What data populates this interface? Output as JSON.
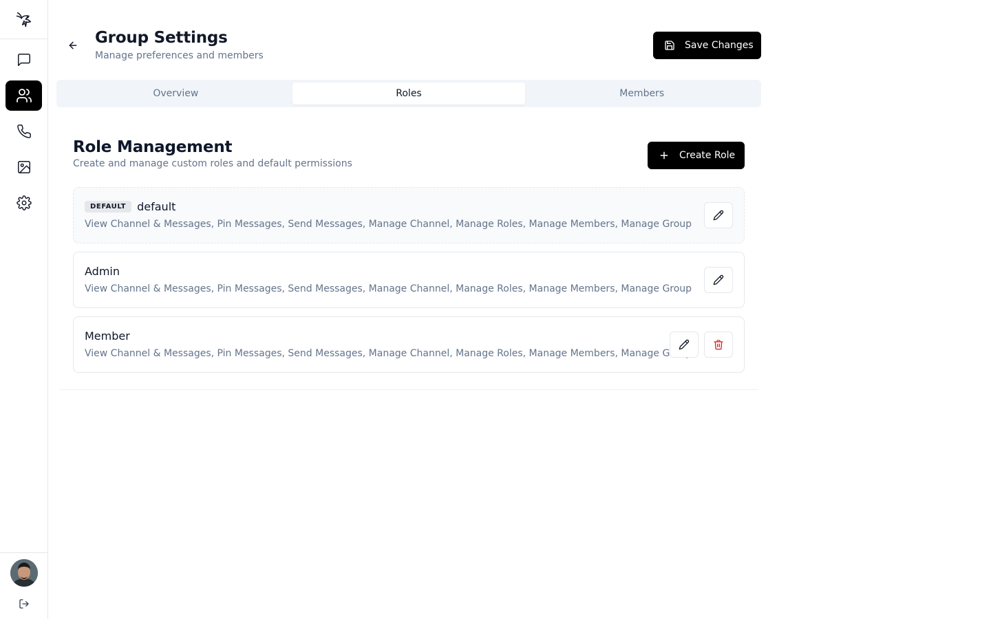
{
  "sidebar": {
    "logo_icon": "hummingbird-logo",
    "items": [
      {
        "icon": "message-square-icon",
        "label": "Chats"
      },
      {
        "icon": "users-icon",
        "label": "Groups",
        "active": true
      },
      {
        "icon": "phone-icon",
        "label": "Calls"
      },
      {
        "icon": "image-icon",
        "label": "Media"
      },
      {
        "icon": "gear-icon",
        "label": "Settings"
      }
    ],
    "logout_icon": "logout-icon"
  },
  "header": {
    "title": "Group Settings",
    "subtitle": "Manage preferences and members",
    "save_label": "Save Changes"
  },
  "tabs": [
    {
      "label": "Overview",
      "active": false
    },
    {
      "label": "Roles",
      "active": true
    },
    {
      "label": "Members",
      "active": false
    }
  ],
  "roles_section": {
    "title": "Role Management",
    "subtitle": "Create and manage custom roles and default permissions",
    "create_label": "Create Role",
    "roles": [
      {
        "badge": "DEFAULT",
        "name": "default",
        "permissions": "View Channel & Messages, Pin Messages, Send Messages, Manage Channel, Manage Roles, Manage Members, Manage Group",
        "deletable": false
      },
      {
        "name": "Admin",
        "permissions": "View Channel & Messages, Pin Messages, Send Messages, Manage Channel, Manage Roles, Manage Members, Manage Group",
        "deletable": false
      },
      {
        "name": "Member",
        "permissions": "View Channel & Messages, Pin Messages, Send Messages, Manage Channel, Manage Roles, Manage Members, Manage Group",
        "deletable": true
      }
    ]
  },
  "colors": {
    "primary": "#000000",
    "muted_text": "#64748b",
    "danger": "#dc2626",
    "tab_bg": "#f1f5f9"
  }
}
